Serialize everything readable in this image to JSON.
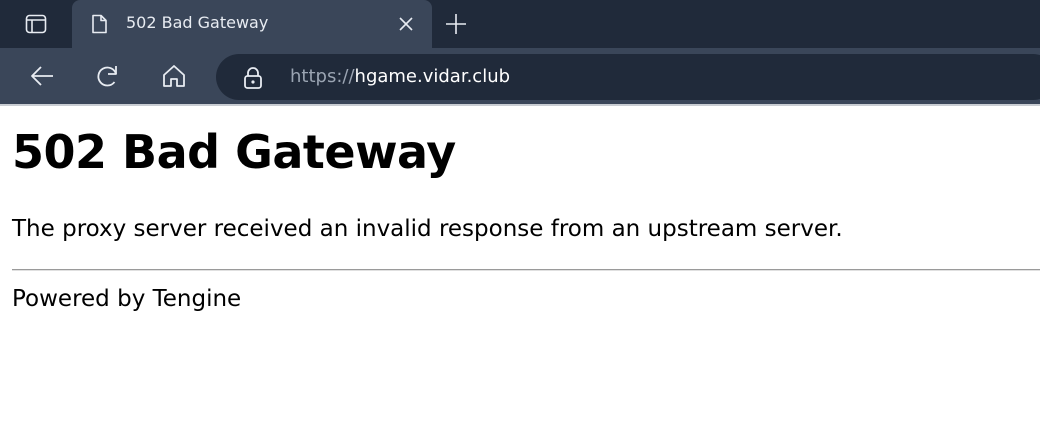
{
  "browser": {
    "tab": {
      "title": "502 Bad Gateway",
      "favicon": "page-icon"
    },
    "icons": {
      "tab_actions": "tab-actions-icon",
      "close": "close-icon",
      "new_tab": "plus-icon",
      "back": "back-arrow-icon",
      "refresh": "refresh-icon",
      "home": "home-icon",
      "lock": "lock-icon"
    },
    "address": {
      "protocol": "https://",
      "host": "hgame.vidar.club"
    },
    "colors": {
      "tabstrip": "#202a3a",
      "toolbar": "#3a4659",
      "omnibox": "#202a3a"
    }
  },
  "page": {
    "heading": "502 Bad Gateway",
    "message": "The proxy server received an invalid response from an upstream server.",
    "footer": "Powered by Tengine"
  }
}
